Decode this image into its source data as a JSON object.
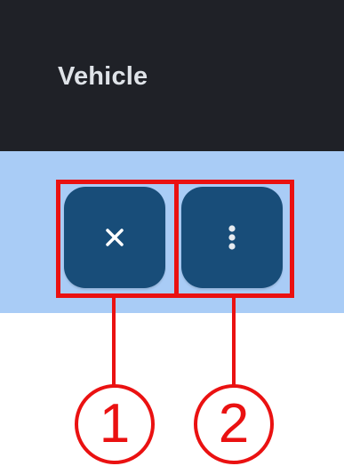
{
  "header": {
    "title": "Vehicle"
  },
  "row_actions": {
    "close_icon": "close-icon",
    "more_icon": "more-vertical-icon"
  },
  "annotations": [
    {
      "label": "1"
    },
    {
      "label": "2"
    }
  ],
  "colors": {
    "header_bg": "#1f2127",
    "row_bg": "#a9ccf6",
    "button_bg": "#184d79",
    "highlight": "#ea1111"
  }
}
